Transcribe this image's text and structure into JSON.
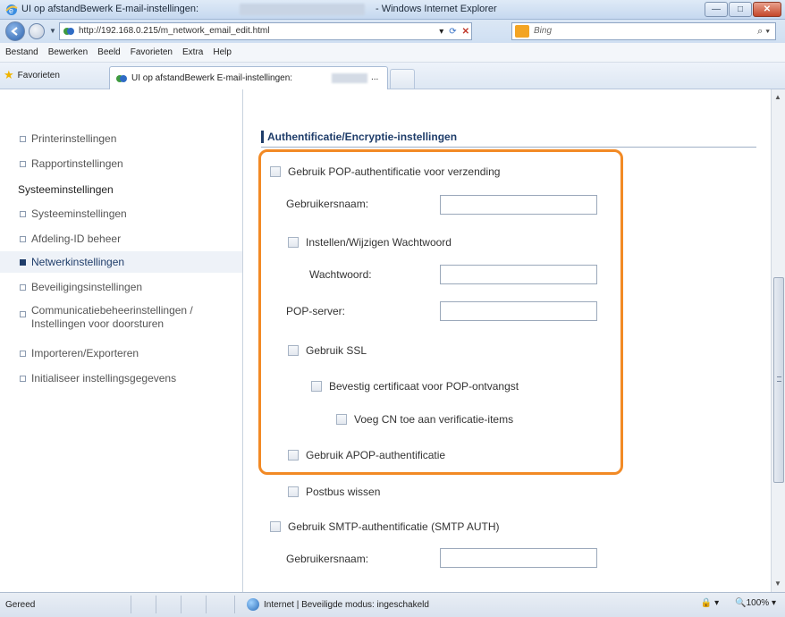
{
  "window": {
    "title": "UI op afstandBewerk E-mail-instellingen:",
    "app_name": "- Windows Internet Explorer",
    "minimize": "—",
    "maximize": "□",
    "close": "✕"
  },
  "address": {
    "url": "http://192.168.0.215/m_network_email_edit.html",
    "search_engine": "Bing"
  },
  "menu": [
    "Bestand",
    "Bewerken",
    "Beeld",
    "Favorieten",
    "Extra",
    "Help"
  ],
  "favorites": {
    "label": "Favorieten",
    "tab_title": "UI op afstandBewerk E-mail-instellingen:",
    "tab_ellipsis": "..."
  },
  "sidebar": {
    "items": [
      {
        "label": "Printerinstellingen"
      },
      {
        "label": "Rapportinstellingen"
      }
    ],
    "heading": "Systeeminstellingen",
    "sub_items": [
      {
        "label": "Systeeminstellingen"
      },
      {
        "label": "Afdeling-ID beheer"
      },
      {
        "label": "Netwerkinstellingen",
        "active": true
      },
      {
        "label": "Beveiligingsinstellingen"
      },
      {
        "label": "Communicatiebeheerinstellingen /",
        "label2": "Instellingen voor doorsturen"
      },
      {
        "label": "Importeren/Exporteren"
      },
      {
        "label": "Initialiseer instellingsgegevens"
      }
    ]
  },
  "form": {
    "section_title": "Authentificatie/Encryptie-instellingen",
    "pop_auth": "Gebruik POP-authentificatie voor verzending",
    "username_label": "Gebruikersnaam:",
    "set_password": "Instellen/Wijzigen Wachtwoord",
    "password_label": "Wachtwoord:",
    "pop_server_label": "POP-server:",
    "use_ssl": "Gebruik SSL",
    "verify_cert": "Bevestig certificaat voor POP-ontvangst",
    "add_cn": "Voeg CN toe aan verificatie-items",
    "apop": "Gebruik APOP-authentificatie",
    "clear_mailbox": "Postbus wissen",
    "smtp_auth": "Gebruik SMTP-authentificatie (SMTP AUTH)",
    "smtp_username_label": "Gebruikersnaam:",
    "highlight_color": "#f28a25"
  },
  "status": {
    "text": "Gereed",
    "zone": "Internet | Beveiligde modus: ingeschakeld",
    "zoom": "100%"
  }
}
